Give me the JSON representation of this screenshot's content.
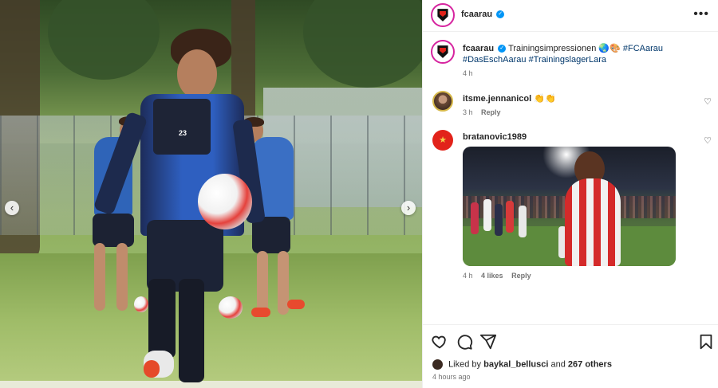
{
  "post": {
    "photo_alt_icon": "training-photo",
    "nav_prev_icon": "chevron-left-icon",
    "nav_next_icon": "chevron-right-icon",
    "jersey_number": "23"
  },
  "header": {
    "username": "fcaarau",
    "more_icon": "more-icon"
  },
  "caption": {
    "username": "fcaarau",
    "text": "Trainingsimpressionen",
    "emojis": "🌏🎨",
    "hashtag_1": "#FCAarau",
    "hashtag_2": "#DasEschAarau",
    "hashtag_3": "#TrainingslagerLara",
    "time": "4 h"
  },
  "comments": [
    {
      "username": "itsme.jennanicol",
      "text": "👏👏",
      "time": "3 h",
      "reply": "Reply"
    },
    {
      "username": "bratanovic1989",
      "time": "4 h",
      "likes": "4 likes",
      "reply": "Reply"
    }
  ],
  "actions": {
    "like_icon": "heart-icon",
    "comment_icon": "comment-icon",
    "share_icon": "share-icon",
    "save_icon": "bookmark-icon"
  },
  "likes": {
    "prefix": "Liked by",
    "user": "baykal_bellusci",
    "mid": "and",
    "others": "267 others"
  },
  "posted": "4 hours ago",
  "colors": {
    "link": "#00376b",
    "verified": "#0095f6",
    "muted": "#737373"
  }
}
